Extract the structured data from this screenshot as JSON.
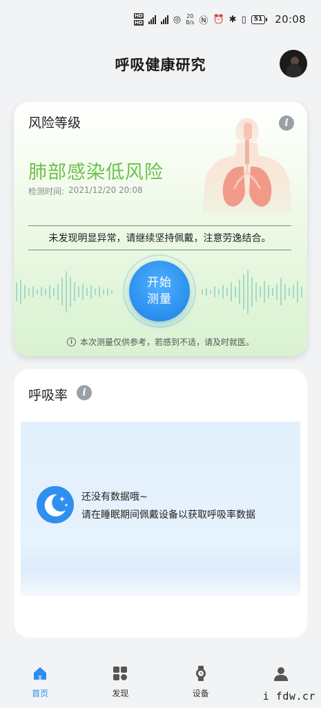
{
  "status_bar": {
    "hd_top": "HD",
    "hd_bottom": "HD",
    "net_speed": "20",
    "net_unit": "B/s",
    "battery": "51",
    "time": "20:08"
  },
  "header": {
    "title": "呼吸健康研究"
  },
  "risk_card": {
    "label": "风险等级",
    "result": "肺部感染低风险",
    "detect_time_label": "检测时间:",
    "detect_time_value": "2021/12/20 20:08",
    "advice": "未发现明显异常，请继续坚持佩戴，注意劳逸结合。",
    "measure_line1": "开始",
    "measure_line2": "测量",
    "disclaimer": "本次测量仅供参考，若感到不适，请及时就医。",
    "result_color": "#6cc24a",
    "button_color": "#2f93f0"
  },
  "resp_card": {
    "title": "呼吸率",
    "no_data": "还没有数据哦~",
    "hint": "请在睡眠期间佩戴设备以获取呼吸率数据"
  },
  "nav": {
    "items": [
      {
        "label": "首页",
        "icon": "home-icon",
        "active": true
      },
      {
        "label": "发现",
        "icon": "discover-icon",
        "active": false
      },
      {
        "label": "设备",
        "icon": "watch-icon",
        "active": false
      },
      {
        "label": "",
        "icon": "person-icon",
        "active": false
      }
    ],
    "active_color": "#2c8cf0"
  },
  "watermark": "i fdw.cr"
}
